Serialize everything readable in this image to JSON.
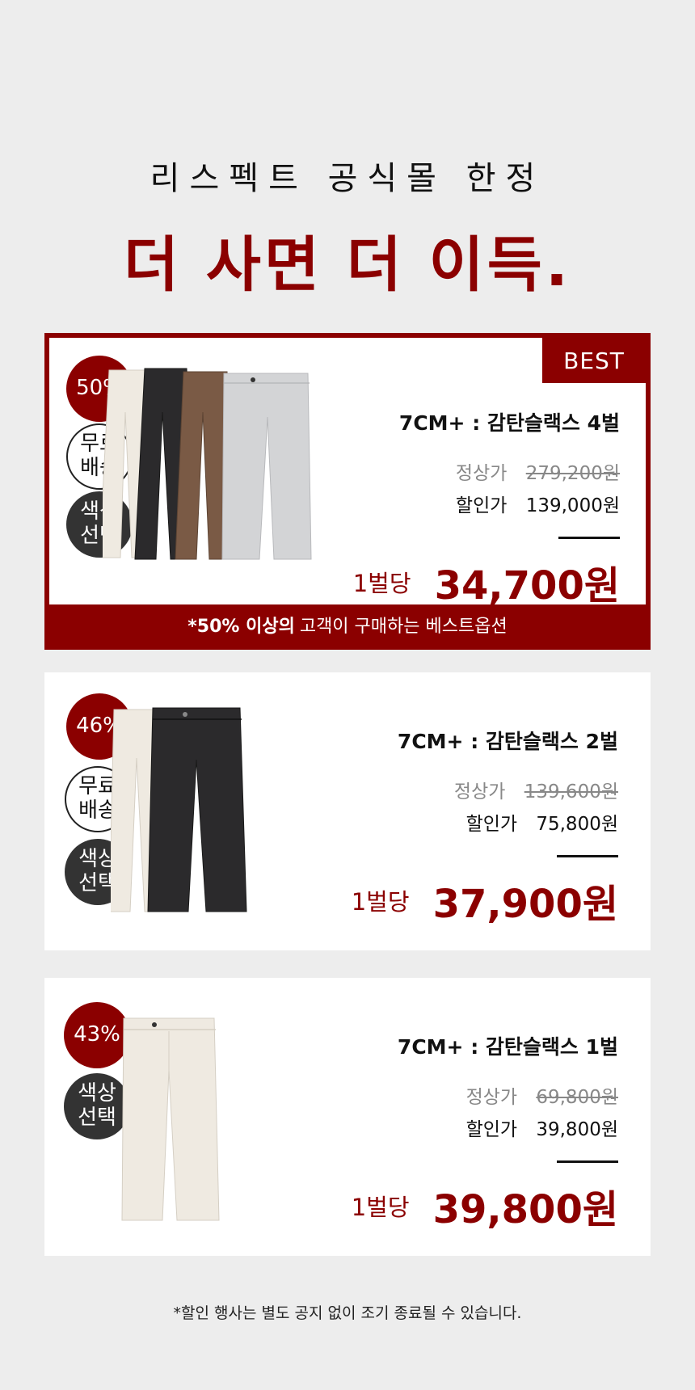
{
  "header": {
    "subtitle": "리스펙트 공식몰 한정",
    "title": "더 사면 더 이득."
  },
  "cards": [
    {
      "best_tag": "BEST",
      "discount": "50%",
      "badges": [
        "무료\n배송",
        "색상\n선택"
      ],
      "name": "7CM+ : 감탄슬랙스 4벌",
      "regular_label": "정상가",
      "regular_price": "279,200원",
      "sale_label": "할인가",
      "sale_price": "139,000원",
      "per_label": "1벌당",
      "per_price": "34,700원",
      "footer_bold": "*50% 이상의",
      "footer_rest": "고객이 구매하는 베스트옵션",
      "pant_colors": [
        "#efeae1",
        "#2b2a2c",
        "#7a5a45",
        "#d3d4d6"
      ]
    },
    {
      "discount": "46%",
      "badges": [
        "무료\n배송",
        "색상\n선택"
      ],
      "name": "7CM+ : 감탄슬랙스 2벌",
      "regular_label": "정상가",
      "regular_price": "139,600원",
      "sale_label": "할인가",
      "sale_price": "75,800원",
      "per_label": "1벌당",
      "per_price": "37,900원",
      "pant_colors": [
        "#efeae1",
        "#2b2a2c"
      ]
    },
    {
      "discount": "43%",
      "badges": [
        "색상\n선택"
      ],
      "name": "7CM+ : 감탄슬랙스 1벌",
      "regular_label": "정상가",
      "regular_price": "69,800원",
      "sale_label": "할인가",
      "sale_price": "39,800원",
      "per_label": "1벌당",
      "per_price": "39,800원",
      "pant_colors": [
        "#efeae1"
      ]
    }
  ],
  "footnote": "*할인 행사는 별도 공지 없이 조기 종료될 수 있습니다.",
  "colors": {
    "accent": "#8b0000",
    "dark_badge": "#333333",
    "background": "#ededed"
  }
}
